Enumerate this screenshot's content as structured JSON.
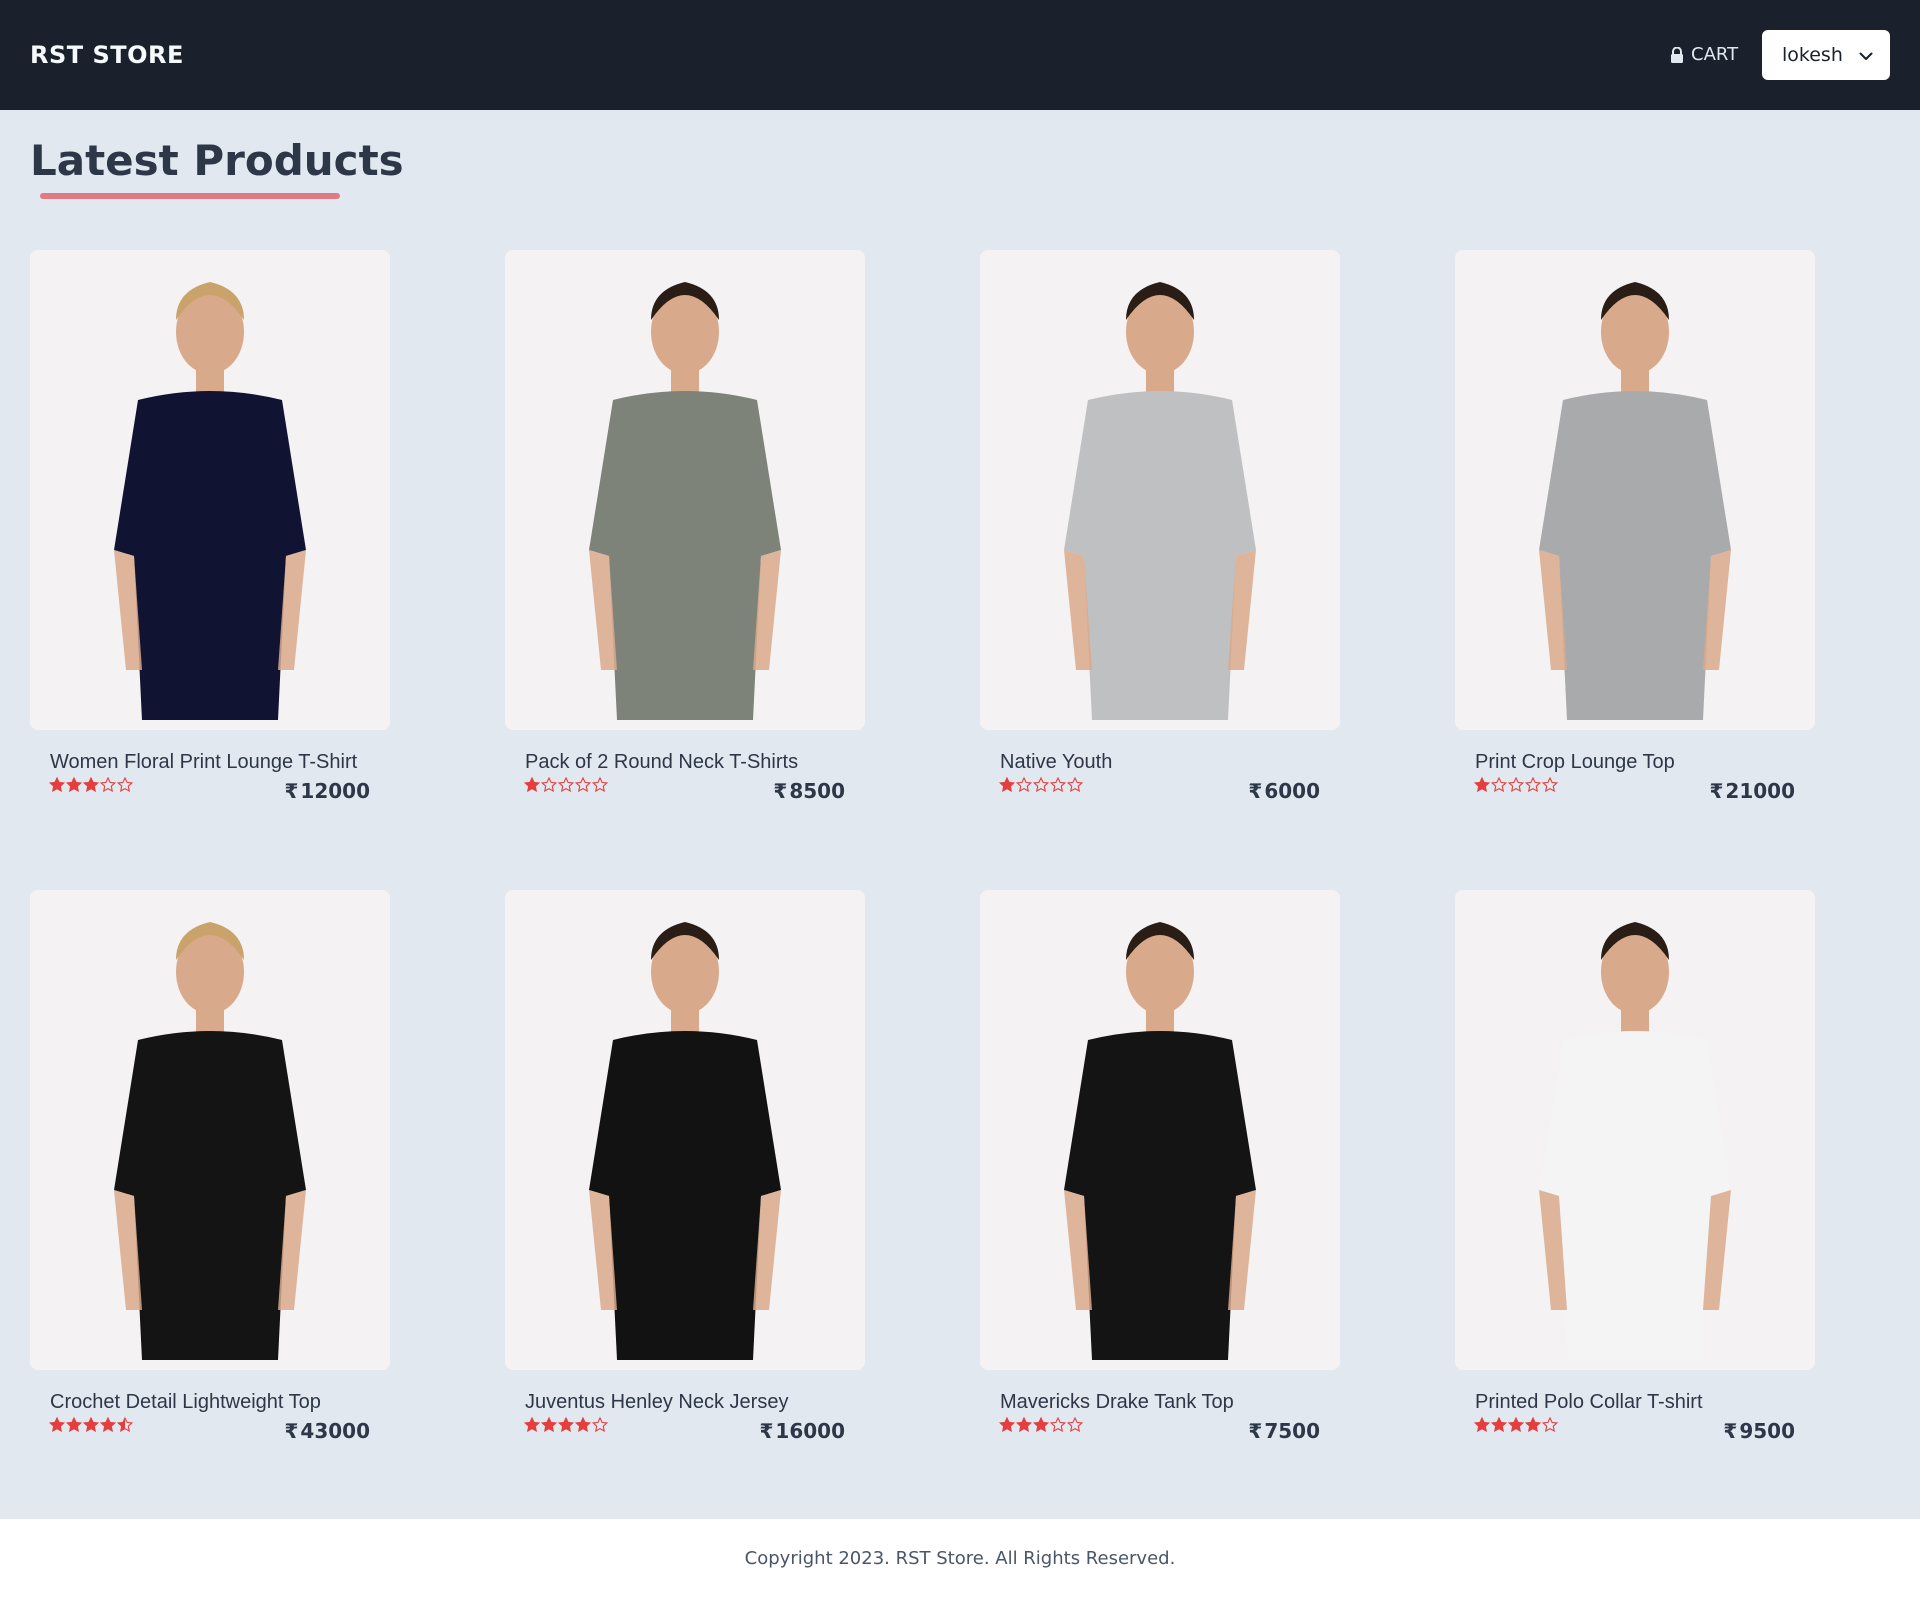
{
  "app": {
    "brand": "RST STORE",
    "accent_color": "#e07b85",
    "nav_background": "#1a202c",
    "page_background": "#e2e8f0"
  },
  "nav": {
    "cart_label": "CART",
    "cart_icon": "lock-icon",
    "user_name": "lokesh",
    "user_menu_icon": "chevron-down-icon"
  },
  "main": {
    "title": "Latest Products"
  },
  "products": [
    {
      "name": "Women Floral Print Lounge T-Shirt",
      "rating": 3,
      "price": "12000",
      "currency_symbol": "₹",
      "image_icon": "product-photo-polka-dot-dress",
      "garment_color": "#101432"
    },
    {
      "name": "Pack of 2 Round Neck T-Shirts",
      "rating": 1,
      "price": "8500",
      "currency_symbol": "₹",
      "image_icon": "product-photo-tie-dye-tshirt",
      "garment_color": "#7d8378"
    },
    {
      "name": "Native Youth",
      "rating": 1,
      "price": "6000",
      "currency_symbol": "₹",
      "image_icon": "product-photo-grey-tank-top",
      "garment_color": "#bfc0c1"
    },
    {
      "name": "Print Crop Lounge Top",
      "rating": 1,
      "price": "21000",
      "currency_symbol": "₹",
      "image_icon": "product-photo-grey-sweatshirt",
      "garment_color": "#a9aaac"
    },
    {
      "name": "Crochet Detail Lightweight Top",
      "rating": 4.5,
      "price": "43000",
      "currency_symbol": "₹",
      "image_icon": "product-photo-black-dress",
      "garment_color": "#141414"
    },
    {
      "name": "Juventus Henley Neck Jersey",
      "rating": 4,
      "price": "16000",
      "currency_symbol": "₹",
      "image_icon": "product-photo-black-sweater",
      "garment_color": "#121212"
    },
    {
      "name": "Mavericks Drake Tank Top",
      "rating": 3,
      "price": "7500",
      "currency_symbol": "₹",
      "image_icon": "product-photo-black-tank-top",
      "garment_color": "#141414"
    },
    {
      "name": "Printed Polo Collar T-shirt",
      "rating": 4,
      "price": "9500",
      "currency_symbol": "₹",
      "image_icon": "product-photo-white-top",
      "garment_color": "#f4f4f4"
    }
  ],
  "rating_color": "#e53e3e",
  "footer": {
    "text": "Copyright 2023. RST Store. All Rights Reserved."
  }
}
